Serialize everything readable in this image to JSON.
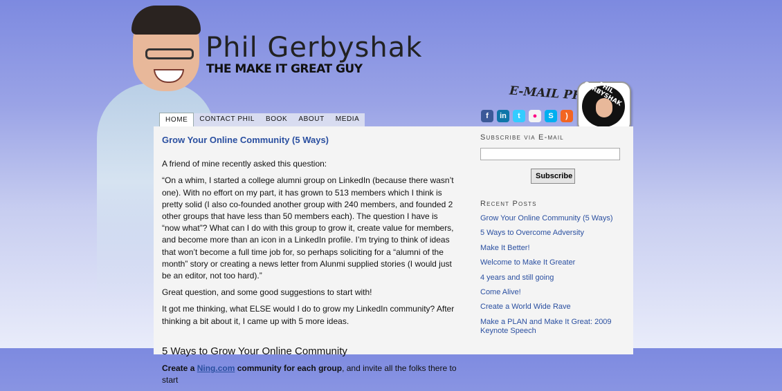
{
  "header": {
    "site_title": "Phil  Gerbyshak",
    "tagline": "THE MAKE IT GREAT GUY",
    "email_label": "E-MAIL PHIL",
    "badge_text": "PHIL GERBYSHAK"
  },
  "social_icons": [
    "facebook-icon",
    "linkedin-icon",
    "twitter-icon",
    "flickr-icon",
    "skype-icon",
    "rss-icon"
  ],
  "nav": {
    "items": [
      {
        "label": "HOME"
      },
      {
        "label": "CONTACT PHIL"
      },
      {
        "label": "BOOK"
      },
      {
        "label": "ABOUT"
      },
      {
        "label": "MEDIA"
      }
    ]
  },
  "post": {
    "title": "Grow Your Online Community (5 Ways)",
    "p1": "A friend of mine recently asked this question:",
    "quote": "“On a whim, I started a college alumni group on LinkedIn (because there wasn’t one).  With no effort on my part, it has grown to 513 members which I think is pretty solid (I also co-founded another group with 240 members, and founded 2 other groups that have less than 50 members each).  The question I have is “now what”?  What can I do with this group to grow it, create value for members, and become more than an icon in a LinkedIn profile.  I’m trying to think of ideas that won’t become a full time job for, so perhaps soliciting for a “alumni of the month” story or creating a news letter from Alunmi supplied stories (I would just be an editor, not too hard).”",
    "p2": "Great question, and some good suggestions to start with!",
    "p3": "It got me thinking, what ELSE would I do to grow my LinkedIn community? After thinking a bit about it, I came up with 5 more ideas.",
    "subhead": "5 Ways to Grow Your Online Community",
    "bold_start": "Create a ",
    "link_text": "Ning.com",
    "bold_end": " community for each group",
    "tail": ", and invite all the folks there to start"
  },
  "sidebar": {
    "subscribe_heading": "Subscribe via E-mail",
    "subscribe_button": "Subscribe",
    "recent_heading": "Recent Posts",
    "recent_posts": [
      {
        "label": "Grow Your Online Community (5 Ways)"
      },
      {
        "label": "5 Ways to Overcome Adversity"
      },
      {
        "label": "Make It Better!"
      },
      {
        "label": "Welcome to Make It Greater"
      },
      {
        "label": "4 years and still going"
      },
      {
        "label": "Come Alive!"
      },
      {
        "label": "Create a World Wide Rave"
      },
      {
        "label": "Make a PLAN and Make It Great: 2009 Keynote Speech"
      }
    ]
  },
  "colors": {
    "link": "#2a4fa0",
    "bg_top": "#7d8ae0"
  }
}
